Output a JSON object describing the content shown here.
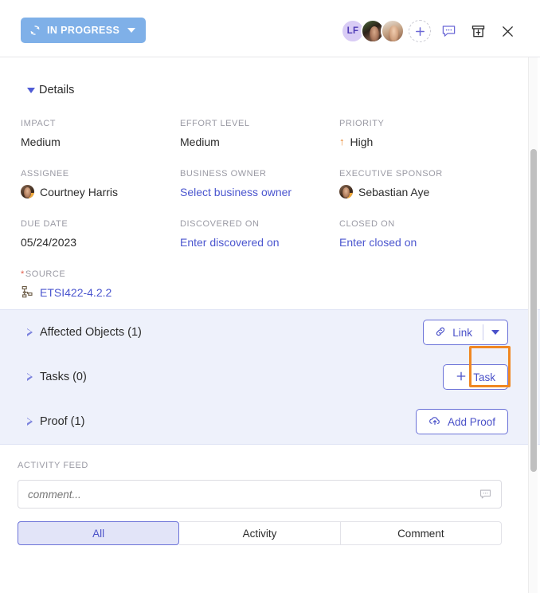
{
  "header": {
    "status_label": "IN PROGRESS",
    "status_color": "#7fb0e8",
    "avatars": [
      {
        "type": "initials",
        "label": "LF"
      },
      {
        "type": "photo",
        "label": ""
      },
      {
        "type": "photo",
        "label": ""
      }
    ],
    "add_person_label": "+",
    "comment_icon": "comment-icon",
    "archive_icon": "archive-icon",
    "close_icon": "close-icon"
  },
  "details": {
    "section_title": "Details",
    "fields": [
      {
        "label": "IMPACT",
        "value": "Medium",
        "kind": "text"
      },
      {
        "label": "EFFORT LEVEL",
        "value": "Medium",
        "kind": "text"
      },
      {
        "label": "PRIORITY",
        "value": "High",
        "kind": "priority",
        "arrow": "↑",
        "arrow_color": "#e8842a"
      },
      {
        "label": "ASSIGNEE",
        "value": "Courtney Harris",
        "kind": "person"
      },
      {
        "label": "BUSINESS OWNER",
        "value": "Select business owner",
        "kind": "link"
      },
      {
        "label": "EXECUTIVE SPONSOR",
        "value": "Sebastian Aye",
        "kind": "person"
      },
      {
        "label": "DUE DATE",
        "value": "05/24/2023",
        "kind": "text"
      },
      {
        "label": "DISCOVERED ON",
        "value": "Enter discovered on",
        "kind": "link"
      },
      {
        "label": "CLOSED ON",
        "value": "Enter closed on",
        "kind": "link"
      },
      {
        "label": "SOURCE",
        "value": "ETSI422-4.2.2",
        "kind": "source",
        "required": true,
        "required_mark": "*"
      }
    ]
  },
  "relations": [
    {
      "label": "Affected Objects (1)",
      "button": "Link",
      "button_type": "split",
      "icon": "link-icon"
    },
    {
      "label": "Tasks (0)",
      "button": "Task",
      "button_type": "plain",
      "icon": "plus-icon"
    },
    {
      "label": "Proof (1)",
      "button": "Add Proof",
      "button_type": "plain",
      "icon": "cloud-upload-icon"
    }
  ],
  "activity": {
    "label": "ACTIVITY FEED",
    "comment_value": "",
    "comment_placeholder": "comment...",
    "comment_icon": "comment-icon",
    "tabs": [
      {
        "label": "All",
        "active": true
      },
      {
        "label": "Activity",
        "active": false
      },
      {
        "label": "Comment",
        "active": false
      }
    ]
  },
  "highlight": {
    "color": "#f08722"
  }
}
